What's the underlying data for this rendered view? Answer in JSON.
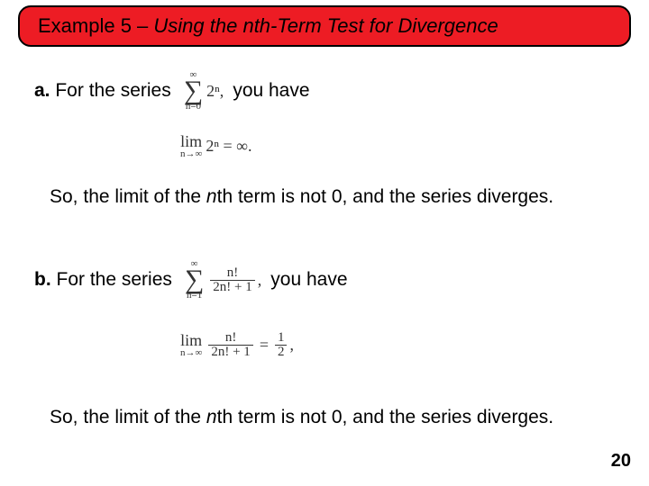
{
  "title": {
    "prefix": "Example 5 – ",
    "italic": "Using the nth-Term Test for Divergence"
  },
  "part_a": {
    "label": "a.",
    "lead": "For the series",
    "tail": "you have",
    "sum_top": "∞",
    "sum_bot": "n=0",
    "summand": "2ⁿ,",
    "limit_expr": "2ⁿ = ∞.",
    "lim_label": "lim",
    "lim_sub": "n→∞",
    "conclusion_pre": "So, the limit of the ",
    "conclusion_nth": "n",
    "conclusion_post": "th term is not 0, and the series diverges."
  },
  "part_b": {
    "label": "b.",
    "lead": "For the series",
    "tail": "you have",
    "sum_top": "∞",
    "sum_bot": "n=1",
    "summand_num": "n!",
    "summand_den": "2n! + 1",
    "summand_suffix": ",",
    "lim_label": "lim",
    "lim_sub": "n→∞",
    "limit_num": "n!",
    "limit_den": "2n! + 1",
    "limit_eq_num": "1",
    "limit_eq_den": "2",
    "limit_eq_suffix": ",",
    "conclusion_pre": "So, the limit of the ",
    "conclusion_nth": "n",
    "conclusion_post": "th term is not 0, and the series diverges."
  },
  "page_number": "20"
}
